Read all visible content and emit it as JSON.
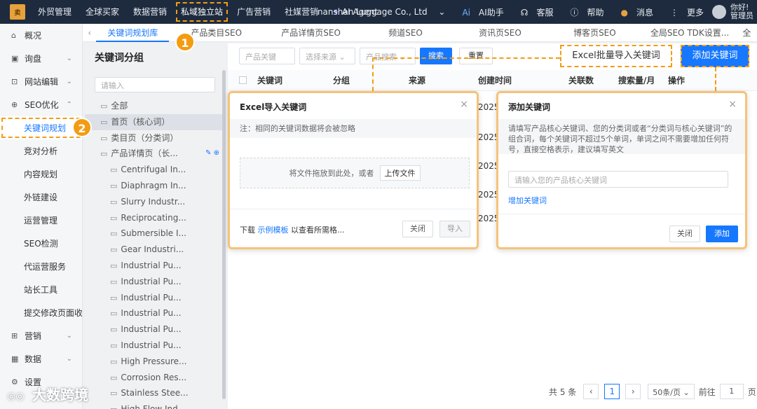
{
  "topbar": {
    "logo": "卖",
    "nav": [
      "外贸管理",
      "全球买家",
      "数据营销",
      "私域独立站",
      "广告营销",
      "社媒营销",
      "AI Agent"
    ],
    "company": "nanshan Luggage Co., Ltd",
    "assistant": "AI助手",
    "service": "客服",
    "help": "帮助",
    "message": "消息",
    "more": "更多",
    "user": "你好! 管理员"
  },
  "sidebar": {
    "items": [
      {
        "label": "概况",
        "icon": "home-icon"
      },
      {
        "label": "询盘",
        "icon": "inbox-icon"
      },
      {
        "label": "网站编辑",
        "icon": "edit-icon"
      },
      {
        "label": "SEO优化",
        "icon": "seo-icon"
      },
      {
        "label": "关键词规划"
      },
      {
        "label": "竞对分析"
      },
      {
        "label": "内容规划"
      },
      {
        "label": "外链建设"
      },
      {
        "label": "运营管理"
      },
      {
        "label": "SEO检测"
      },
      {
        "label": "代运营服务"
      },
      {
        "label": "站长工具"
      },
      {
        "label": "提交修改页面收录"
      },
      {
        "label": "营销",
        "icon": "marketing-icon"
      },
      {
        "label": "数据",
        "icon": "data-icon"
      },
      {
        "label": "设置",
        "icon": "settings-icon"
      }
    ]
  },
  "tabs": [
    "关键词规划库",
    "产品类目SEO",
    "产品详情页SEO",
    "频道SEO",
    "资讯页SEO",
    "博客页SEO",
    "全局SEO TDK设置...",
    "全"
  ],
  "groups": {
    "title": "关键词分组",
    "search_placeholder": "请输入",
    "tree": [
      {
        "label": "全部",
        "level": 1
      },
      {
        "label": "首页（核心词）",
        "level": 1
      },
      {
        "label": "类目页（分类词）",
        "level": 1
      },
      {
        "label": "产品详情页（长...",
        "level": 1
      },
      {
        "label": "Centrifugal In...",
        "level": 2
      },
      {
        "label": "Diaphragm In...",
        "level": 2
      },
      {
        "label": "Slurry Industr...",
        "level": 2
      },
      {
        "label": "Reciprocating...",
        "level": 2
      },
      {
        "label": "Submersible I...",
        "level": 2
      },
      {
        "label": "Gear Industri...",
        "level": 2
      },
      {
        "label": "Industrial Pu...",
        "level": 2
      },
      {
        "label": "Industrial Pu...",
        "level": 2
      },
      {
        "label": "Industrial Pu...",
        "level": 2
      },
      {
        "label": "Industrial Pu...",
        "level": 2
      },
      {
        "label": "Industrial Pu...",
        "level": 2
      },
      {
        "label": "Industrial Pu...",
        "level": 2
      },
      {
        "label": "High Pressure...",
        "level": 2
      },
      {
        "label": "Corrosion Res...",
        "level": 2
      },
      {
        "label": "Stainless Stee...",
        "level": 2
      },
      {
        "label": "High Flow Ind...",
        "level": 2
      }
    ]
  },
  "filters": {
    "keyword_placeholder": "产品关键",
    "source_placeholder": "选择来源",
    "product_placeholder": "产品搜索",
    "search": "搜索",
    "reset": "重置",
    "excel_import": "Excel批量导入关键词",
    "add_keyword": "添加关键词"
  },
  "table": {
    "headers": [
      "关键词",
      "分组",
      "来源",
      "创建时间",
      "关联数",
      "搜索量/月",
      "操作"
    ],
    "dates": [
      "2025",
      "2025",
      "2025",
      "2025",
      "2025"
    ]
  },
  "pagination": {
    "total": "共 5 条",
    "page": "1",
    "page_size": "50条/页",
    "goto_label": "前往",
    "goto_value": "1",
    "goto_suffix": "页"
  },
  "excel_dialog": {
    "title": "Excel导入关键词",
    "note": "注：相同的关键词数据将会被忽略",
    "drop_text": "将文件拖放到此处，或者",
    "upload": "上传文件",
    "download": "下载",
    "template_link": "示例模板",
    "download_suffix": "以查看所需格...",
    "close": "关闭",
    "import": "导入"
  },
  "add_dialog": {
    "title": "添加关键词",
    "note": "请填写产品核心关键词、您的分类词或者“分类词与核心关键词”的组合词，每个关键词不超过5个单词，单词之间不需要增加任何符号，直接空格表示，建议填写英文",
    "input_placeholder": "请输入您的产品核心关键词",
    "add_link": "增加关键词",
    "close": "关闭",
    "confirm": "添加"
  },
  "markers": [
    "1",
    "2"
  ],
  "watermark": "大数跨境",
  "colors": {
    "accent": "#1677ff",
    "highlight": "#f39c12",
    "topbar": "#1e2b3e"
  }
}
